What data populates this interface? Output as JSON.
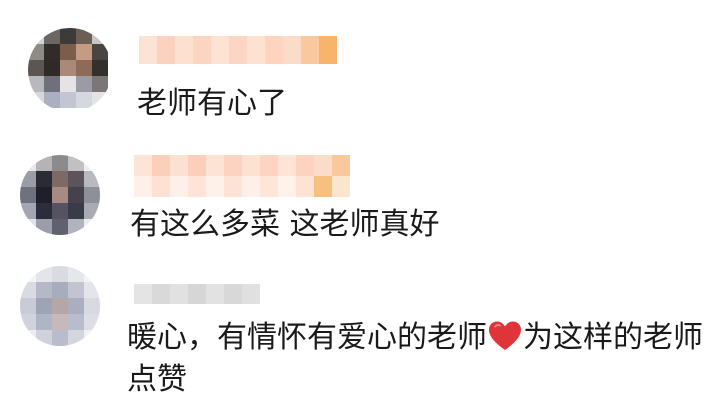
{
  "comments": [
    {
      "text": "老师有心了"
    },
    {
      "text": "有这么多菜 这老师真好"
    },
    {
      "text_part1": "暖心，有情怀有爱心的老师",
      "icon": "heart-icon",
      "text_part2": "为这样的老师",
      "text_line2": "点赞"
    }
  ],
  "colors": {
    "username_blur_peach": "#fbd7c2",
    "username_blur_orange": "#f7b46a",
    "username_blur_gray": "#dcdcdc",
    "heart": "#e0343b"
  }
}
